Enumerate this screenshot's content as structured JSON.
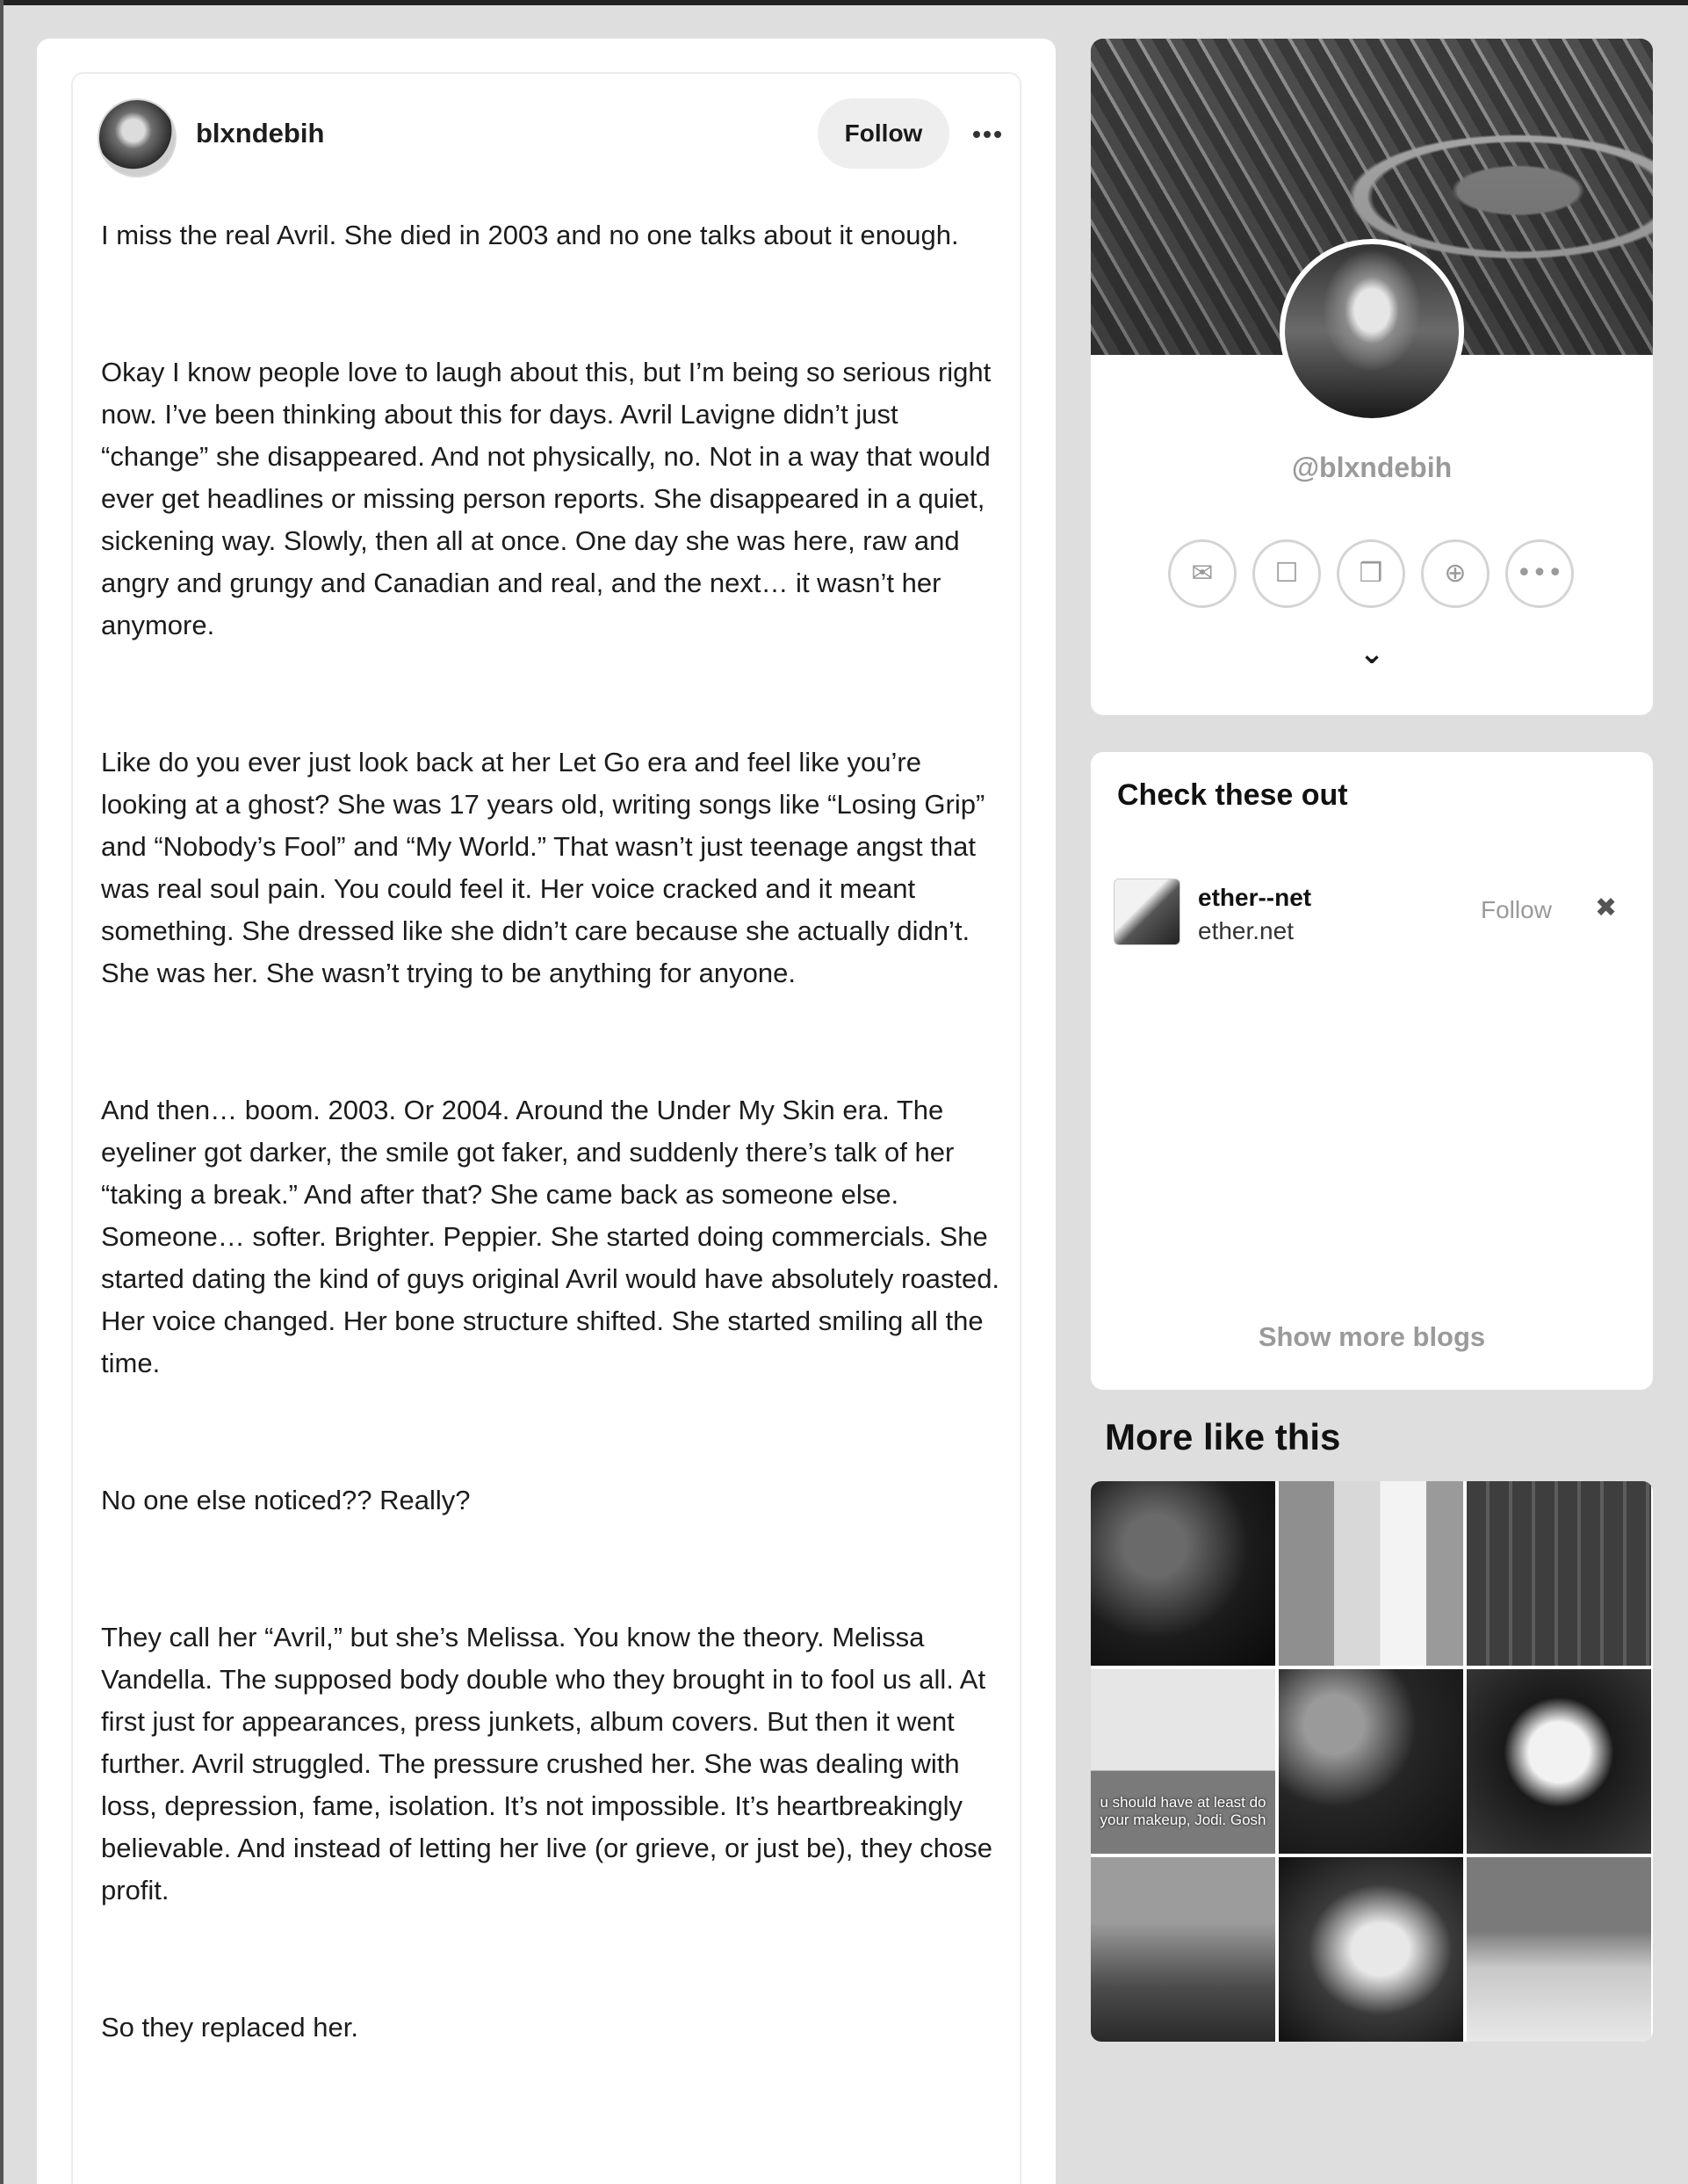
{
  "post": {
    "username": "blxndebih",
    "follow_label": "Follow",
    "more_icon": "more-horizontal-icon",
    "paragraphs": [
      "I miss the real Avril. She died in 2003 and no one talks about it enough.",
      "Okay I know people love to laugh about this, but I’m being so serious right now. I’ve been thinking about this for days. Avril Lavigne didn’t just “change”  she disappeared. And not physically, no. Not in a way that would ever get headlines or missing person reports. She disappeared in a quiet, sickening way. Slowly, then all at once. One day she was here, raw and angry and grungy and Canadian and real, and the next… it wasn’t her anymore.",
      "Like do you ever just look back at her Let Go era and feel like you’re looking at a ghost? She was 17 years old, writing songs like “Losing Grip” and “Nobody’s Fool” and “My World.” That wasn’t just teenage angst  that was real soul pain. You could feel it. Her voice cracked and it meant something. She dressed like she didn’t care because she actually didn’t. She was her. She wasn’t trying to be anything for anyone.",
      "And then… boom. 2003. Or 2004. Around the Under My Skin era. The eyeliner got darker, the smile got faker, and suddenly there’s talk of her “taking a break.” And after that? She came back as someone else. Someone… softer. Brighter. Peppier. She started doing commercials. She started dating the kind of guys original Avril would have absolutely roasted. Her voice changed. Her bone structure shifted. She started smiling all the time.",
      "No one else noticed?? Really?",
      "They call her “Avril,” but she’s Melissa. You know the theory. Melissa Vandella. The supposed body double who they brought in to fool us all. At first just for appearances, press junkets, album covers. But then it went further. Avril struggled. The pressure crushed her. She was dealing with loss, depression, fame, isolation. It’s not impossible. It’s heartbreakingly believable. And instead of letting her live (or grieve, or just be), they chose profit.",
      "So they replaced her."
    ]
  },
  "profile": {
    "handle": "@blxndebih",
    "actions": [
      {
        "icon": "mail-icon",
        "glyph": "✉"
      },
      {
        "icon": "add-contact-icon",
        "glyph": "☐"
      },
      {
        "icon": "gift-icon",
        "glyph": "❒"
      },
      {
        "icon": "chat-plus-icon",
        "glyph": "⊕"
      },
      {
        "icon": "more-icon",
        "glyph": "•••"
      }
    ],
    "expand_icon": "chevron-down-icon",
    "expand_glyph": "⌄"
  },
  "suggestions": {
    "title": "Check these out",
    "items": [
      {
        "name": "ether--net",
        "url": "ether.net",
        "follow_label": "Follow",
        "close_glyph": "✖"
      }
    ],
    "show_more_label": "Show more blogs"
  },
  "more_like_this": {
    "title": "More like this",
    "tile_caption": "u should have at least do your makeup, Jodi. Gosh"
  }
}
